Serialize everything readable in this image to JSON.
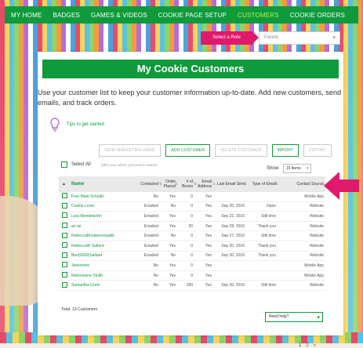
{
  "nav": {
    "items": [
      "MY HOME",
      "BADGES",
      "GAMES & VIDEOS",
      "COOKIE PAGE SETUP",
      "CUSTOMERS",
      "COOKIE ORDERS"
    ],
    "active_index": 4
  },
  "role": {
    "button_label": "Select a Role",
    "select_value": "Parent"
  },
  "page": {
    "title": "My Cookie Customers",
    "intro": "Use your customer list to keep your customer information up-to-date. Add new customers, send emails, and track orders.",
    "tips_label": "Tips to get started"
  },
  "actions": {
    "send_email": "SEND MARKETING EMAIL",
    "add_customer": "ADD CUSTOMER",
    "delete_customer": "DELETE CUSTOMER",
    "import": "IMPORT",
    "export": "EXPORT"
  },
  "select_all": {
    "label": "Select All",
    "hint": "(after you select, proceed to action)"
  },
  "show": {
    "label": "Show:",
    "value": "15 Items"
  },
  "table": {
    "headers": [
      "Name",
      "Contacted",
      "Order Placed",
      "# of Boxes",
      "Email Address",
      "Last Email Sent",
      "Type of Email",
      "Contact Source"
    ],
    "rows": [
      [
        "Fran Marit Schuldt",
        "No",
        "Yes",
        "0",
        "Yes",
        "",
        "",
        "Mobile App"
      ],
      [
        "Cookie Lover",
        "Emailed",
        "No",
        "0",
        "Yes",
        "Sep 30, 2016",
        "Open",
        "Website"
      ],
      [
        "Lara Mendelsohn",
        "Emailed",
        "Yes",
        "0",
        "Yes",
        "Sep 22, 2016",
        "Still time",
        "Website"
      ],
      [
        "ari ari",
        "Emailed",
        "Yes",
        "30",
        "Yes",
        "Sep 28, 2016",
        "Thank you",
        "Website"
      ],
      [
        "RebeccaBooktexorsaslib",
        "Emailed",
        "No",
        "0",
        "Yes",
        "Sep 27, 2016",
        "Still time",
        "Website"
      ],
      [
        "RebeccaW Salterd",
        "Emailed",
        "Yes",
        "0",
        "Yes",
        "Sep 30, 2016",
        "Thank you",
        "Website"
      ],
      [
        "Ben(0009)Saltard",
        "Emailed",
        "No",
        "0",
        "Yes",
        "Sep 30, 2016",
        "Thank you",
        "Website"
      ],
      [
        "Jetsonone",
        "No",
        "Yes",
        "0",
        "Yes",
        "",
        "",
        "Mobile App"
      ],
      [
        "Rebonnone Smith",
        "No",
        "Yes",
        "0",
        "Yes",
        "",
        "",
        "Mobile App"
      ],
      [
        "Samantha Gune",
        "No",
        "Yes",
        "180",
        "Yes",
        "Sep 30, 2016",
        "Still time",
        "Website"
      ]
    ]
  },
  "pager": {
    "current": "1",
    "next": "2",
    "next_arrow": "»"
  },
  "total": "Total: 13 Customers",
  "help": "Need help?",
  "colors": {
    "brand_green": "#0f9a3c",
    "accent_pink": "#e0196b",
    "nav_active": "#b8f24a"
  }
}
